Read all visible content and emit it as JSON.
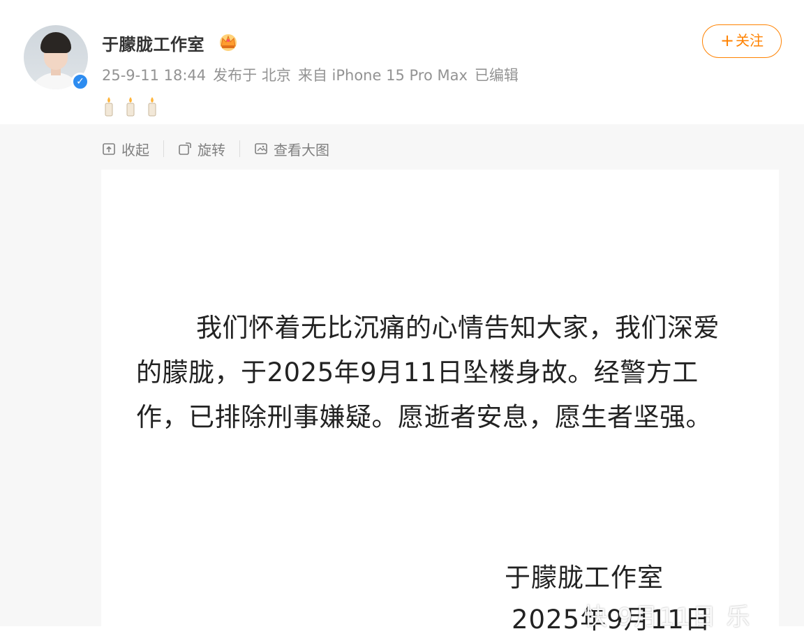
{
  "post": {
    "author": "于朦胧工作室",
    "meta": {
      "time": "25-9-11 18:44",
      "location": "发布于 北京",
      "source": "来自 iPhone 15 Pro Max",
      "edited": "已编辑"
    },
    "follow_label": "关注"
  },
  "toolbar": {
    "collapse": "收起",
    "rotate": "旋转",
    "view_large": "查看大图"
  },
  "notice": {
    "body": "我们怀着无比沉痛的心情告知大家，我们深爱的朦胧，于2025年9月11日坠楼身故。经警方工作，已排除刑事嫌疑。愿逝者安息，愿生者坚强。",
    "signature": "于朦胧工作室",
    "date": "2025年9月11日"
  },
  "watermark": "快 9月11日 乐",
  "colors": {
    "accent": "#ff8200",
    "verified": "#2d8cf0",
    "meta_text": "#939393"
  },
  "icons": [
    "verified-icon",
    "crown-icon",
    "candle-icon",
    "collapse-icon",
    "rotate-icon",
    "view-large-icon"
  ]
}
